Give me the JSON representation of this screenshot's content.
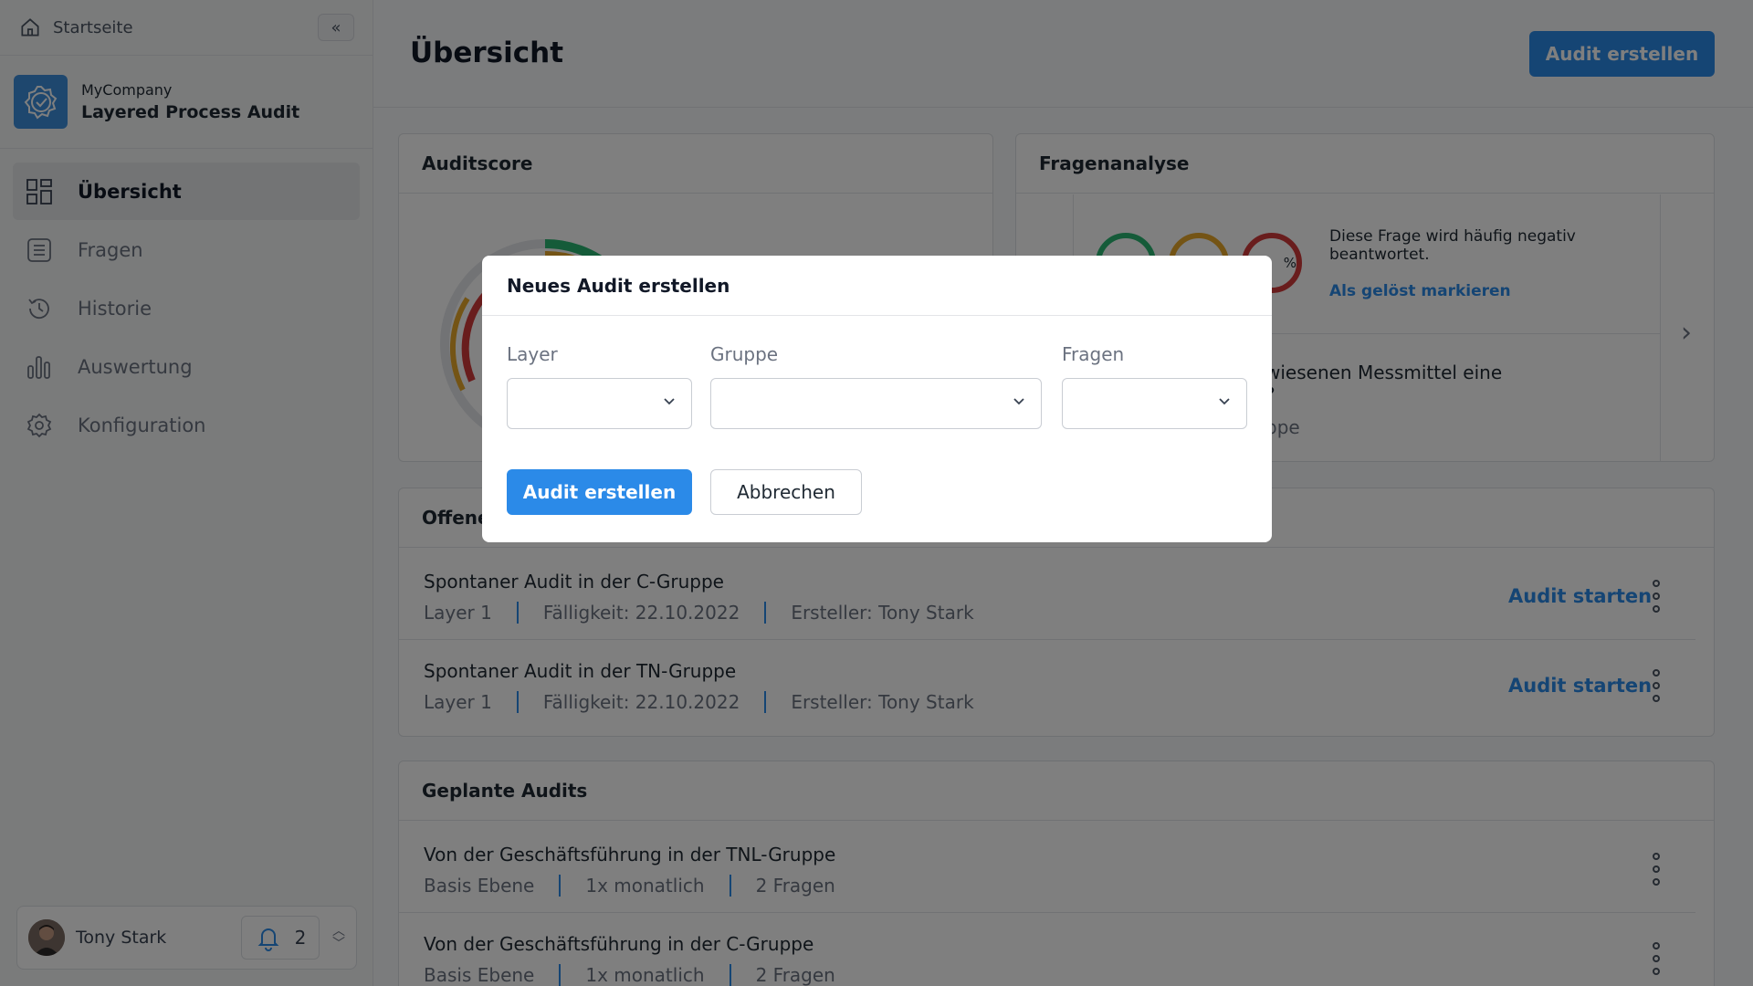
{
  "sidebar": {
    "home_label": "Startseite",
    "company_name": "MyCompany",
    "app_name": "Layered Process Audit",
    "nav": [
      {
        "label": "Übersicht",
        "icon": "grid-icon"
      },
      {
        "label": "Fragen",
        "icon": "list-icon"
      },
      {
        "label": "Historie",
        "icon": "history-icon"
      },
      {
        "label": "Auswertung",
        "icon": "bar-chart-icon"
      },
      {
        "label": "Konfiguration",
        "icon": "gear-icon"
      }
    ],
    "user_name": "Tony Stark",
    "notification_count": "2"
  },
  "header": {
    "title": "Übersicht",
    "create_button": "Audit erstellen"
  },
  "score_card": {
    "title": "Auditscore"
  },
  "question_card": {
    "title": "Fragenanalyse",
    "circle_label_partial": "%",
    "negative_text": "Diese Frage wird häufig negativ beantwortet.",
    "resolve_link": "Als gelöst markieren",
    "second_question_partial": "wiesenen Messmittel eine",
    "second_question_partial2": "?",
    "second_question_sub_partial": "ppe"
  },
  "open_card": {
    "title_partial": "Offene",
    "rows": [
      {
        "title": "Spontaner Audit in der C-Gruppe",
        "layer": "Layer 1",
        "due": "Fälligkeit: 22.10.2022",
        "creator": "Ersteller: Tony Stark",
        "action": "Audit starten"
      },
      {
        "title": "Spontaner Audit in der TN-Gruppe",
        "layer": "Layer 1",
        "due": "Fälligkeit: 22.10.2022",
        "creator": "Ersteller: Tony Stark",
        "action": "Audit starten"
      }
    ]
  },
  "plan_card": {
    "title": "Geplante Audits",
    "rows": [
      {
        "title": "Von der Geschäftsführung in der  TNL-Gruppe",
        "level": "Basis Ebene",
        "freq": "1x monatlich",
        "count": "2 Fragen"
      },
      {
        "title": "Von der Geschäftsführung in der  C-Gruppe",
        "level": "Basis Ebene",
        "freq": "1x monatlich",
        "count": "2 Fragen"
      }
    ]
  },
  "modal": {
    "title": "Neues Audit erstellen",
    "fields": [
      {
        "label": "Layer",
        "value": ""
      },
      {
        "label": "Gruppe",
        "value": ""
      },
      {
        "label": "Fragen",
        "value": ""
      }
    ],
    "create_button": "Audit erstellen",
    "cancel_button": "Abbrechen"
  },
  "colors": {
    "accent": "#2b8ae8",
    "score_green": "#2bb673",
    "score_yellow": "#e8a92b",
    "score_red": "#d23b3b"
  }
}
